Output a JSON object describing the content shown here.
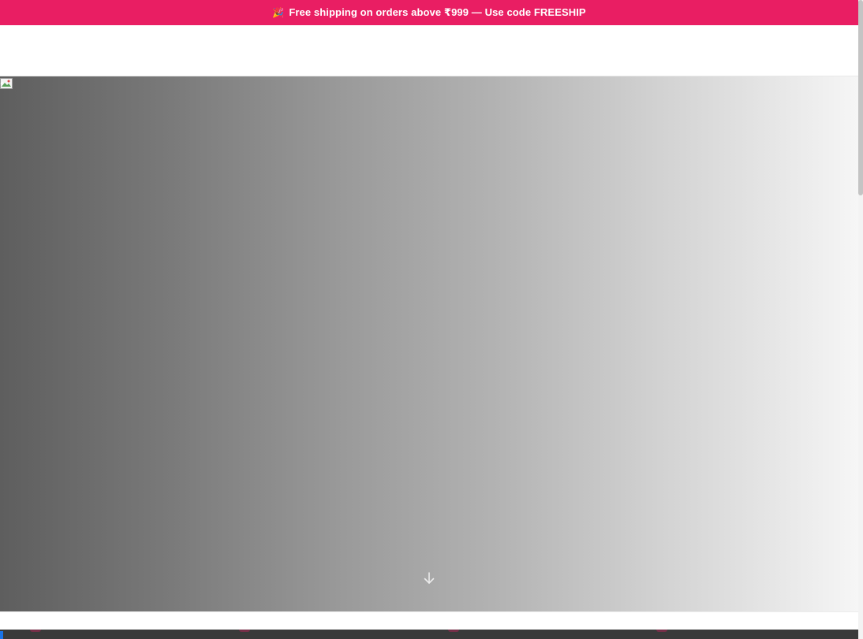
{
  "announcement": {
    "emoji": "🎉",
    "text": "Free shipping on orders above ₹999 — Use code FREESHIP",
    "background_color": "#E91E63",
    "text_color": "#FFFFFF"
  },
  "hero": {
    "image_state": "broken",
    "scroll_icon": "arrow-down-icon"
  },
  "colors": {
    "accent": "#E91E63",
    "bottom_strip": "#3A3A3A"
  }
}
